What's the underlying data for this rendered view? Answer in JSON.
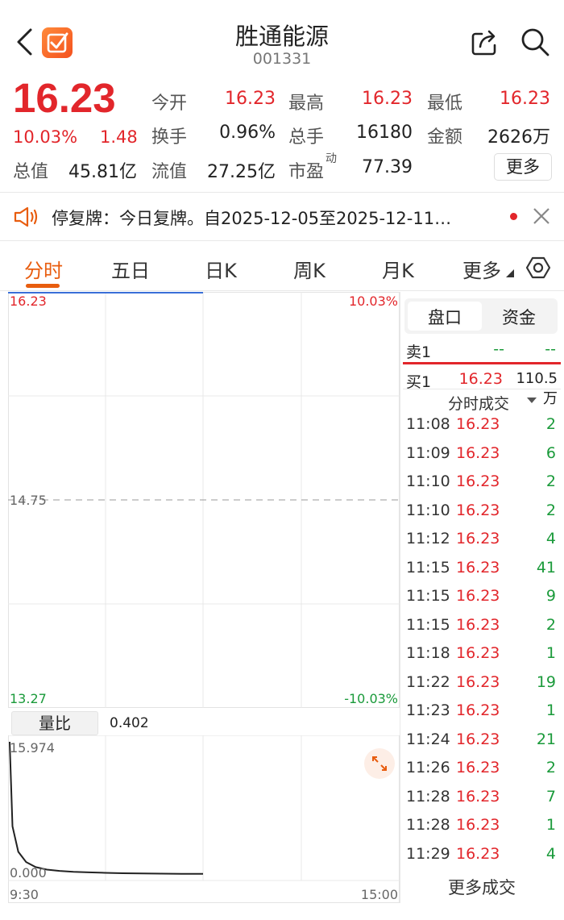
{
  "header": {
    "title": "胜通能源",
    "code": "001331"
  },
  "quote": {
    "price": "16.23",
    "change_pct": "10.03%",
    "change": "1.48",
    "fields": {
      "open_label": "今开",
      "open": "16.23",
      "high_label": "最高",
      "high": "16.23",
      "low_label": "最低",
      "low": "16.23",
      "turnover_label": "换手",
      "turnover": "0.96%",
      "volume_label": "总手",
      "volume": "16180",
      "amount_label": "金额",
      "amount": "2626万",
      "mcap_label": "总值",
      "mcap": "45.81亿",
      "float_label": "流值",
      "float": "27.25亿",
      "pe_label": "市盈",
      "pe_sup": "动",
      "pe": "77.39"
    },
    "more_button": "更多"
  },
  "notice": {
    "text": "停复牌：今日复牌。自2025-12-05至2025-12-11…"
  },
  "tabs": [
    "分时",
    "五日",
    "日K",
    "周K",
    "月K",
    "更多"
  ],
  "chart": {
    "price_top": "16.23",
    "pct_top": "10.03%",
    "price_mid": "14.75",
    "price_bottom": "13.27",
    "pct_bottom": "-10.03%",
    "indicator_tab": "量比",
    "indicator_value": "0.402",
    "ind_top": "15.974",
    "ind_bottom": "0.000",
    "time_start": "9:30",
    "time_end": "15:00"
  },
  "chart_data": {
    "type": "line",
    "series": [
      {
        "values": [
          15.974,
          6.0,
          3.0,
          1.8,
          1.2,
          0.9,
          0.75,
          0.65,
          0.58,
          0.52,
          0.48,
          0.45,
          0.43,
          0.41,
          0.402
        ]
      }
    ],
    "ylim": [
      0,
      15.974
    ]
  },
  "panel": {
    "tab_book": "盘口",
    "tab_funds": "资金",
    "sell1_label": "卖1",
    "sell1_price": "--",
    "sell1_vol": "--",
    "buy1_label": "买1",
    "buy1_price": "16.23",
    "buy1_vol": "110.5万",
    "trades_title": "分时成交",
    "trades": [
      {
        "time": "11:08",
        "price": "16.23",
        "vol": "2"
      },
      {
        "time": "11:09",
        "price": "16.23",
        "vol": "6"
      },
      {
        "time": "11:10",
        "price": "16.23",
        "vol": "2"
      },
      {
        "time": "11:10",
        "price": "16.23",
        "vol": "2"
      },
      {
        "time": "11:12",
        "price": "16.23",
        "vol": "4"
      },
      {
        "time": "11:15",
        "price": "16.23",
        "vol": "41"
      },
      {
        "time": "11:15",
        "price": "16.23",
        "vol": "9"
      },
      {
        "time": "11:15",
        "price": "16.23",
        "vol": "2"
      },
      {
        "time": "11:18",
        "price": "16.23",
        "vol": "1"
      },
      {
        "time": "11:22",
        "price": "16.23",
        "vol": "19"
      },
      {
        "time": "11:23",
        "price": "16.23",
        "vol": "1"
      },
      {
        "time": "11:24",
        "price": "16.23",
        "vol": "21"
      },
      {
        "time": "11:26",
        "price": "16.23",
        "vol": "2"
      },
      {
        "time": "11:28",
        "price": "16.23",
        "vol": "7"
      },
      {
        "time": "11:28",
        "price": "16.23",
        "vol": "1"
      },
      {
        "time": "11:29",
        "price": "16.23",
        "vol": "4"
      }
    ],
    "more_trades": "更多成交"
  },
  "colors": {
    "up": "#e2262b",
    "down": "#1a9a3a",
    "accent": "#e85d0f"
  }
}
